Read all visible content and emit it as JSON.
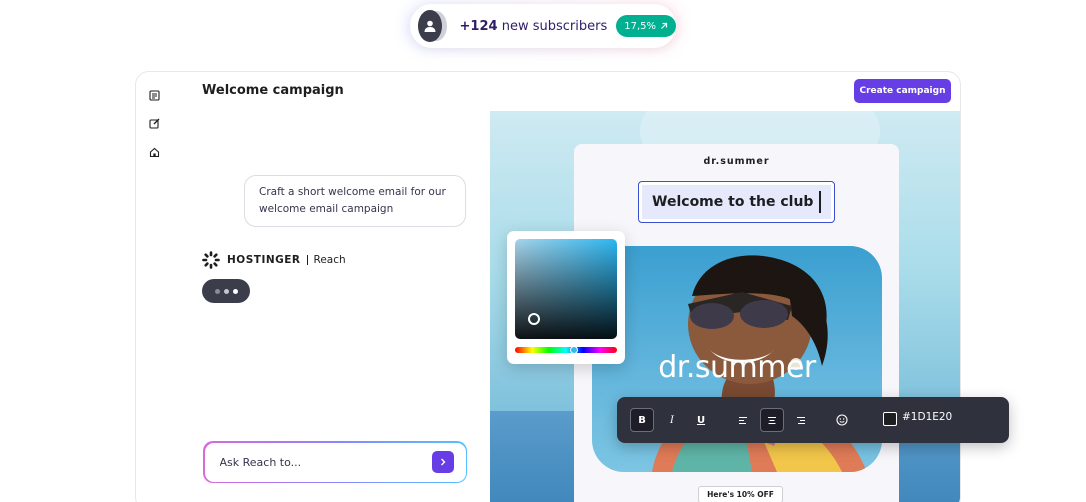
{
  "notification": {
    "count": "+124",
    "text": "new subscribers",
    "badge": "17,5%"
  },
  "campaign": {
    "title": "Welcome campaign",
    "create_label": "Create campaign"
  },
  "chat": {
    "prompt": "Craft a short welcome email for our welcome email campaign",
    "brand_name": "HOSTINGER",
    "brand_product": "Reach",
    "input_placeholder": "Ask Reach to..."
  },
  "email": {
    "brand": "dr.summer",
    "headline": "Welcome to the club",
    "hero_wordmark": "dr.summer",
    "offer": "Here's 10% OFF"
  },
  "toolbar": {
    "bold": "B",
    "italic": "I",
    "underline": "U",
    "color_hex": "#1D1E20"
  },
  "colors": {
    "accent": "#673de6",
    "badge": "#00b090",
    "toolbar": "#2f313d",
    "text_color": "#1d1e20"
  },
  "icons": [
    "user-icon",
    "arrow-up-right-icon",
    "document-icon",
    "edit-icon",
    "home-icon",
    "send-icon",
    "align-left-icon",
    "align-center-icon",
    "align-right-icon",
    "emoji-icon"
  ]
}
